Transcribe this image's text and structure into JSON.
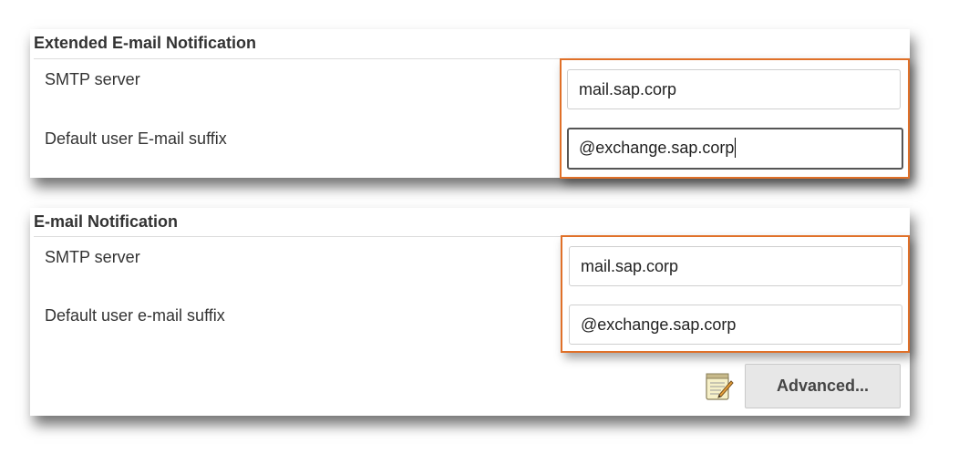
{
  "extended_section": {
    "title": "Extended E-mail Notification",
    "smtp_label": "SMTP server",
    "smtp_value": "mail.sap.corp",
    "suffix_label": "Default user E-mail suffix",
    "suffix_value": "@exchange.sap.corp"
  },
  "email_section": {
    "title": "E-mail Notification",
    "smtp_label": "SMTP server",
    "smtp_value": "mail.sap.corp",
    "suffix_label": "Default user e-mail suffix",
    "suffix_value": "@exchange.sap.corp",
    "advanced_label": "Advanced...",
    "help_icon": "notepad-pencil-icon"
  },
  "colors": {
    "highlight": "#e07028",
    "button_bg": "#e7e7e7",
    "text": "#333333"
  }
}
